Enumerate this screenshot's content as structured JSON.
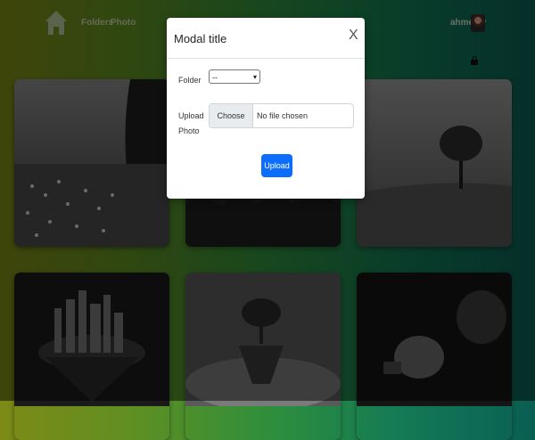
{
  "navbar": {
    "home_icon": "home-icon",
    "links": [
      {
        "label": "Folders"
      },
      {
        "label": "Photo"
      }
    ],
    "user": {
      "name": "ahmed",
      "caret": "▾"
    },
    "lock_icon": "lock-icon"
  },
  "gallery": {
    "cards": [
      {
        "subject": "forest-flowers"
      },
      {
        "subject": "tree-field"
      },
      {
        "subject": "lone-tree"
      },
      {
        "subject": "floating-city"
      },
      {
        "subject": "floating-island"
      },
      {
        "subject": "cat-lightbulb"
      }
    ]
  },
  "modal": {
    "title": "Modal title",
    "close": "X",
    "folder_label": "Folder",
    "folder_value": "--",
    "upload_label_1": "Upload",
    "upload_label_2": "Photo",
    "choose_file": "Choose File",
    "file_status": "No file chosen",
    "upload_button": "Upload"
  },
  "colors": {
    "primary": "#0d6efd",
    "bg_left": "#7d8a16",
    "bg_right": "#0a5f53"
  }
}
